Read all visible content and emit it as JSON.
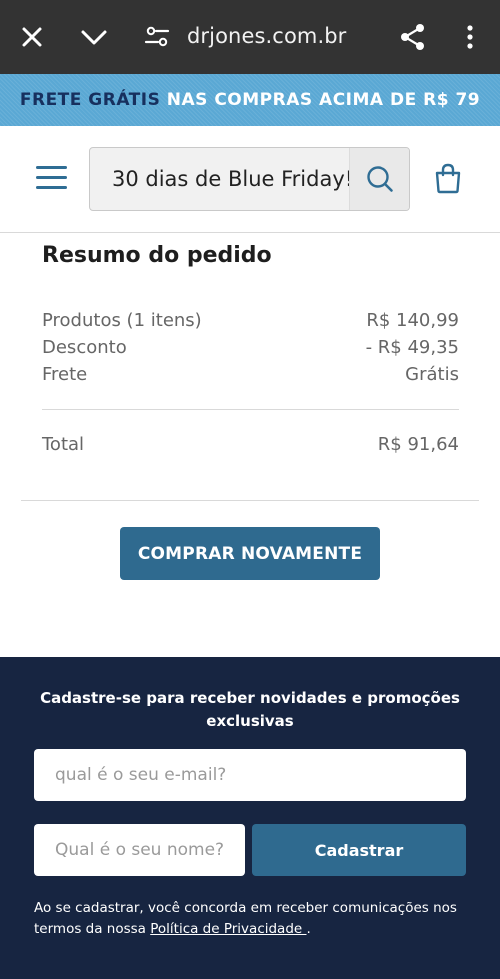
{
  "browser": {
    "url": "drjones.com.br",
    "icons": [
      "close-icon",
      "chevron-down-icon",
      "site-settings-icon",
      "share-icon",
      "more-vert-icon"
    ]
  },
  "promo": {
    "highlight": "FRETE GRÁTIS",
    "rest": " NAS COMPRAS ACIMA DE R$ 79",
    "colors": {
      "background": "#5aa8d4",
      "highlight": "#17305e"
    }
  },
  "header": {
    "search_value": "30 dias de Blue Friday!",
    "icons": [
      "menu-icon",
      "search-icon",
      "shopping-bag-icon"
    ]
  },
  "summary": {
    "title": "Resumo do pedido",
    "rows": [
      {
        "label": "Produtos (1 itens)",
        "value": "R$ 140,99"
      },
      {
        "label": "Desconto",
        "value": "- R$ 49,35"
      },
      {
        "label": "Frete",
        "value": "Grátis"
      }
    ],
    "total_label": "Total",
    "total_value": "R$ 91,64",
    "buy_again_label": "COMPRAR NOVAMENTE"
  },
  "newsletter": {
    "title": "Cadastre-se para receber novidades e promoções exclusivas",
    "email_placeholder": "qual é o seu e-mail?",
    "name_placeholder": "Qual é o seu nome?",
    "submit_label": "Cadastrar",
    "legal_prefix": "Ao se cadastrar, você concorda em receber comunicações nos termos da nossa ",
    "legal_link": "Política de Privacidade ",
    "legal_suffix": "."
  },
  "colors": {
    "accent": "#2f6a8f",
    "footer_bg": "#172541",
    "browser_bar": "#333333"
  }
}
